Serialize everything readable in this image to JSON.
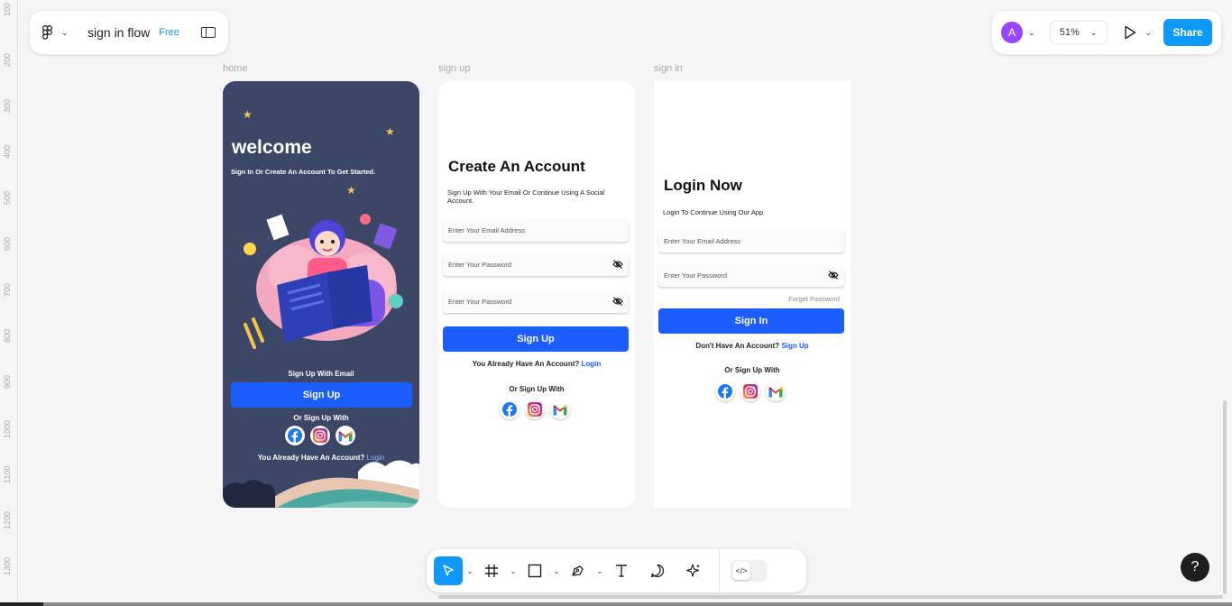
{
  "ruler": [
    "100",
    "200",
    "300",
    "400",
    "500",
    "600",
    "700",
    "800",
    "900",
    "1000",
    "1100",
    "1200",
    "1300"
  ],
  "file": {
    "title": "sign in flow",
    "plan": "Free"
  },
  "header_right": {
    "avatar_initial": "A",
    "zoom": "51%",
    "share_label": "Share"
  },
  "frames": {
    "home": {
      "label": "home",
      "title": "welcome",
      "subtitle": "Sign In Or Create An Account To Get Started.",
      "signup_email": "Sign Up With Email",
      "signup_button": "Sign Up",
      "or_sign_up": "Or Sign Up With",
      "already": "You Already Have An Account?",
      "login_link": "Login"
    },
    "signup": {
      "label": "sign up",
      "title": "Create An Account",
      "subtitle": "Sign Up With Your Email Or Continue Using A Social Account.",
      "email_placeholder": "Enter Your Email Address",
      "password_placeholder": "Enter Your Password",
      "confirm_placeholder": "Enter Your Password",
      "signup_button": "Sign Up",
      "already": "You Already Have An Account?",
      "login_link": "Login",
      "or_sign_up": "Or Sign Up With"
    },
    "signin": {
      "label": "sign in",
      "title": "Login Now",
      "subtitle": "Login To Continue Using Our App",
      "email_placeholder": "Enter Your Email Address",
      "password_placeholder": "Enter Your Password",
      "forget": "Forget Password",
      "signin_button": "Sign In",
      "no_account": "Don't Have An Account?",
      "signup_link": "Sign Up",
      "or_sign_up": "Or Sign Up With"
    }
  },
  "social_icons": [
    "facebook-icon",
    "instagram-icon",
    "gmail-icon"
  ],
  "toolbar": {
    "tools": [
      "move-tool",
      "frame-tool",
      "rectangle-tool",
      "pen-tool",
      "text-tool",
      "comment-tool",
      "actions-tool"
    ],
    "dev_mode_icon": "code-icon"
  },
  "help_label": "?",
  "colors": {
    "accent": "#0d99ff",
    "primary_button": "#1c5dff",
    "home_bg": "#3c4768"
  }
}
